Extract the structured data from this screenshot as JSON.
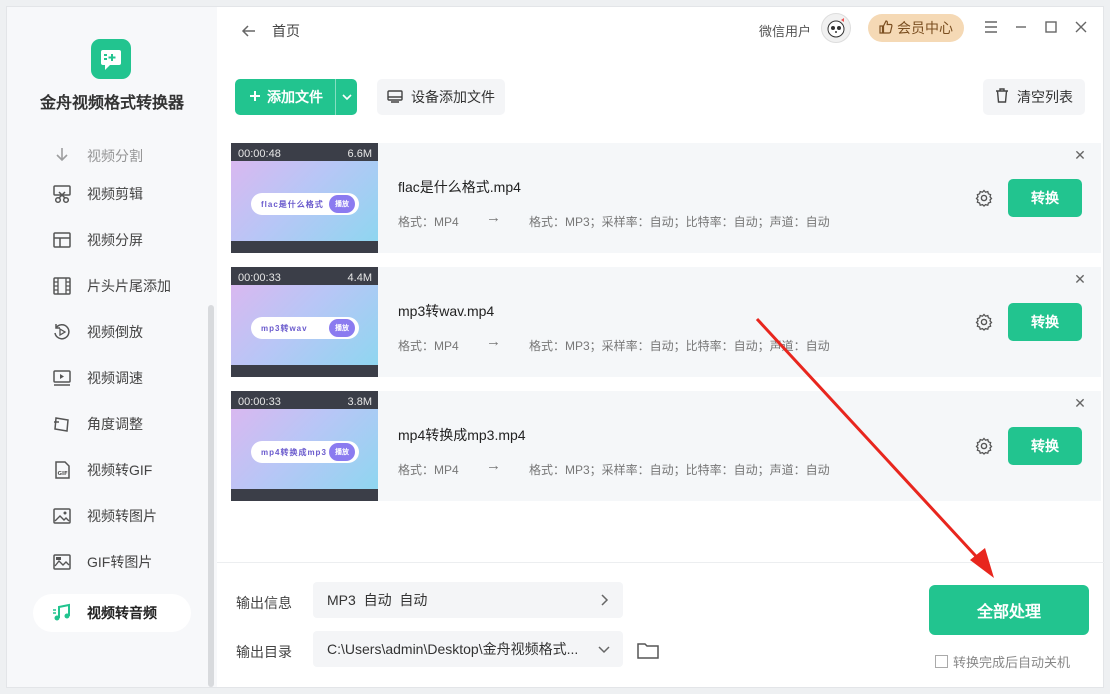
{
  "app": {
    "name": "金舟视频格式转换器",
    "breadcrumb": "首页"
  },
  "user": {
    "name": "微信用户",
    "vip_label": "会员中心"
  },
  "sidebar": {
    "items": [
      {
        "label": "视频分割",
        "icon": "scissors-split-icon"
      },
      {
        "label": "视频剪辑",
        "icon": "cut-icon"
      },
      {
        "label": "视频分屏",
        "icon": "split-screen-icon"
      },
      {
        "label": "片头片尾添加",
        "icon": "film-icon"
      },
      {
        "label": "视频倒放",
        "icon": "rewind-icon"
      },
      {
        "label": "视频调速",
        "icon": "speed-icon"
      },
      {
        "label": "角度调整",
        "icon": "rotate-icon"
      },
      {
        "label": "视频转GIF",
        "icon": "gif-icon"
      },
      {
        "label": "视频转图片",
        "icon": "image-icon"
      },
      {
        "label": "GIF转图片",
        "icon": "gif-image-icon"
      },
      {
        "label": "视频转音频",
        "icon": "music-icon"
      }
    ],
    "active": "视频转音频"
  },
  "toolbar": {
    "add_label": "添加文件",
    "device_label": "设备添加文件",
    "clear_label": "清空列表"
  },
  "files": [
    {
      "name": "flac是什么格式.mp4",
      "duration": "00:00:48",
      "size": "6.6M",
      "thumb_text": "flac是什么格式",
      "thumb_btn": "播放",
      "src_format": "格式：MP4",
      "dst_format": "格式：MP3；采样率：自动；比特率：自动；声道：自动",
      "convert_label": "转换"
    },
    {
      "name": "mp3转wav.mp4",
      "duration": "00:00:33",
      "size": "4.4M",
      "thumb_text": "mp3转wav",
      "thumb_btn": "播放",
      "src_format": "格式：MP4",
      "dst_format": "格式：MP3；采样率：自动；比特率：自动；声道：自动",
      "convert_label": "转换"
    },
    {
      "name": "mp4转换成mp3.mp4",
      "duration": "00:00:33",
      "size": "3.8M",
      "thumb_text": "mp4转换成mp3",
      "thumb_btn": "播放",
      "src_format": "格式：MP4",
      "dst_format": "格式：MP3；采样率：自动；比特率：自动；声道：自动",
      "convert_label": "转换"
    }
  ],
  "output": {
    "info_label": "输出信息",
    "info_value": "MP3  自动  自动",
    "dir_label": "输出目录",
    "dir_value": "C:\\Users\\admin\\Desktop\\金舟视频格式..."
  },
  "process_label": "全部处理",
  "auto_shutdown_label": "转换完成后自动关机",
  "colors": {
    "accent": "#22c48f",
    "vip_bg": "#f5d9b5",
    "annotation_arrow": "#e8261e"
  }
}
